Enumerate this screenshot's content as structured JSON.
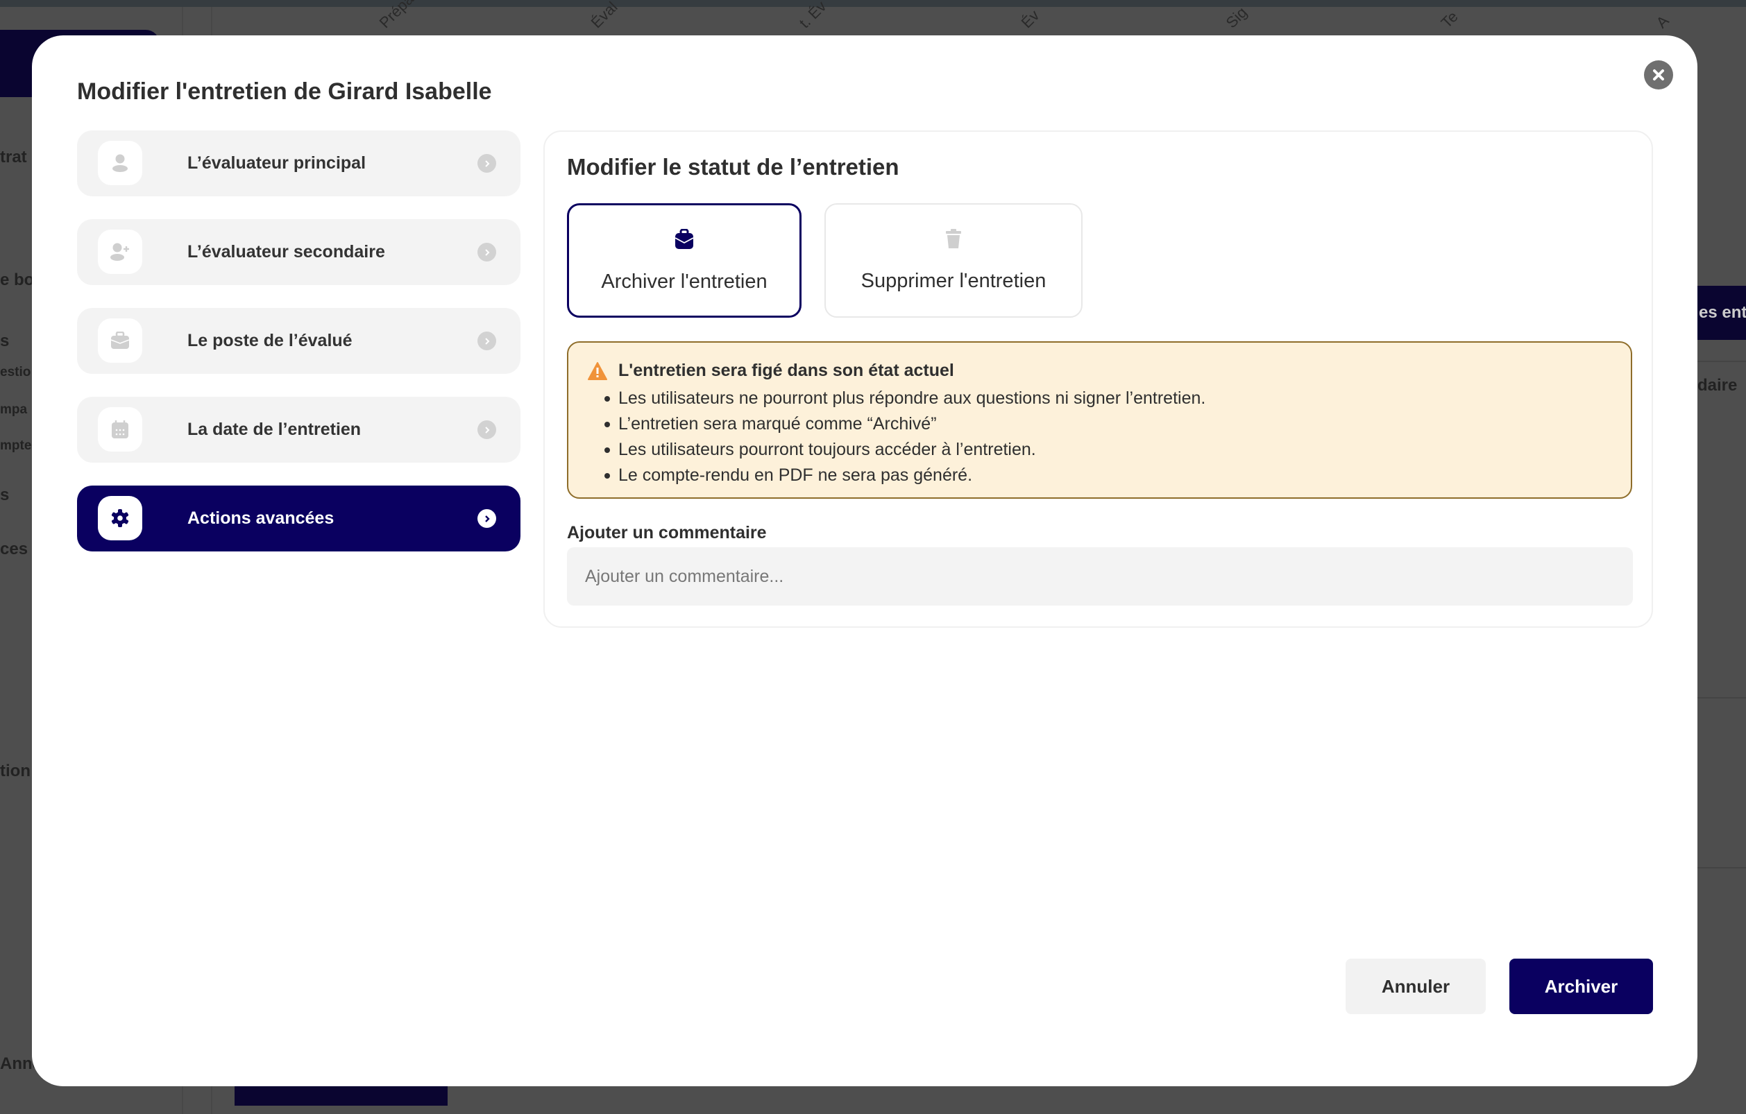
{
  "background": {
    "column_headers": [
      "Prépa",
      "Éval",
      "t. Év",
      "Év",
      "Sig",
      "Te",
      "A"
    ],
    "side_fragments": [
      "trat",
      "e bo",
      "s",
      "estio",
      "mpa",
      "mpte",
      "s",
      "ces",
      "tion",
      "Anne"
    ],
    "right_tab": "es entr",
    "right_text": "daire"
  },
  "modal": {
    "title": "Modifier l'entretien de Girard Isabelle",
    "close_icon": "close-circle-icon",
    "nav": [
      {
        "label": "L’évaluateur principal",
        "icon": "user-icon",
        "active": false
      },
      {
        "label": "L’évaluateur secondaire",
        "icon": "user-plus-icon",
        "active": false
      },
      {
        "label": "Le poste de l’évalué",
        "icon": "briefcase-icon",
        "active": false
      },
      {
        "label": "La date de l’entretien",
        "icon": "calendar-icon",
        "active": false
      },
      {
        "label": "Actions avancées",
        "icon": "gear-icon",
        "active": true
      }
    ],
    "panel": {
      "title": "Modifier le statut de l’entretien",
      "options": [
        {
          "label": "Archiver l'entretien",
          "icon": "archive-bag-icon",
          "selected": true
        },
        {
          "label": "Supprimer l'entretien",
          "icon": "trash-icon",
          "selected": false
        }
      ],
      "warning": {
        "heading": "L'entretien sera figé dans son état actuel",
        "items": [
          "Les utilisateurs ne pourront plus répondre aux questions ni signer l’entretien.",
          "L’entretien sera marqué comme “Archivé”",
          "Les utilisateurs pourront toujours accéder à l’entretien.",
          "Le compte-rendu en PDF ne sera pas généré."
        ]
      },
      "comment": {
        "label": "Ajouter un commentaire",
        "placeholder": "Ajouter un commentaire...",
        "value": ""
      }
    },
    "buttons": {
      "cancel": "Annuler",
      "confirm": "Archiver"
    }
  },
  "colors": {
    "primary": "#0a0060",
    "warning_bg": "#fdf1da",
    "warning_border": "#8e6d2a",
    "warning_icon": "#f0933a"
  }
}
